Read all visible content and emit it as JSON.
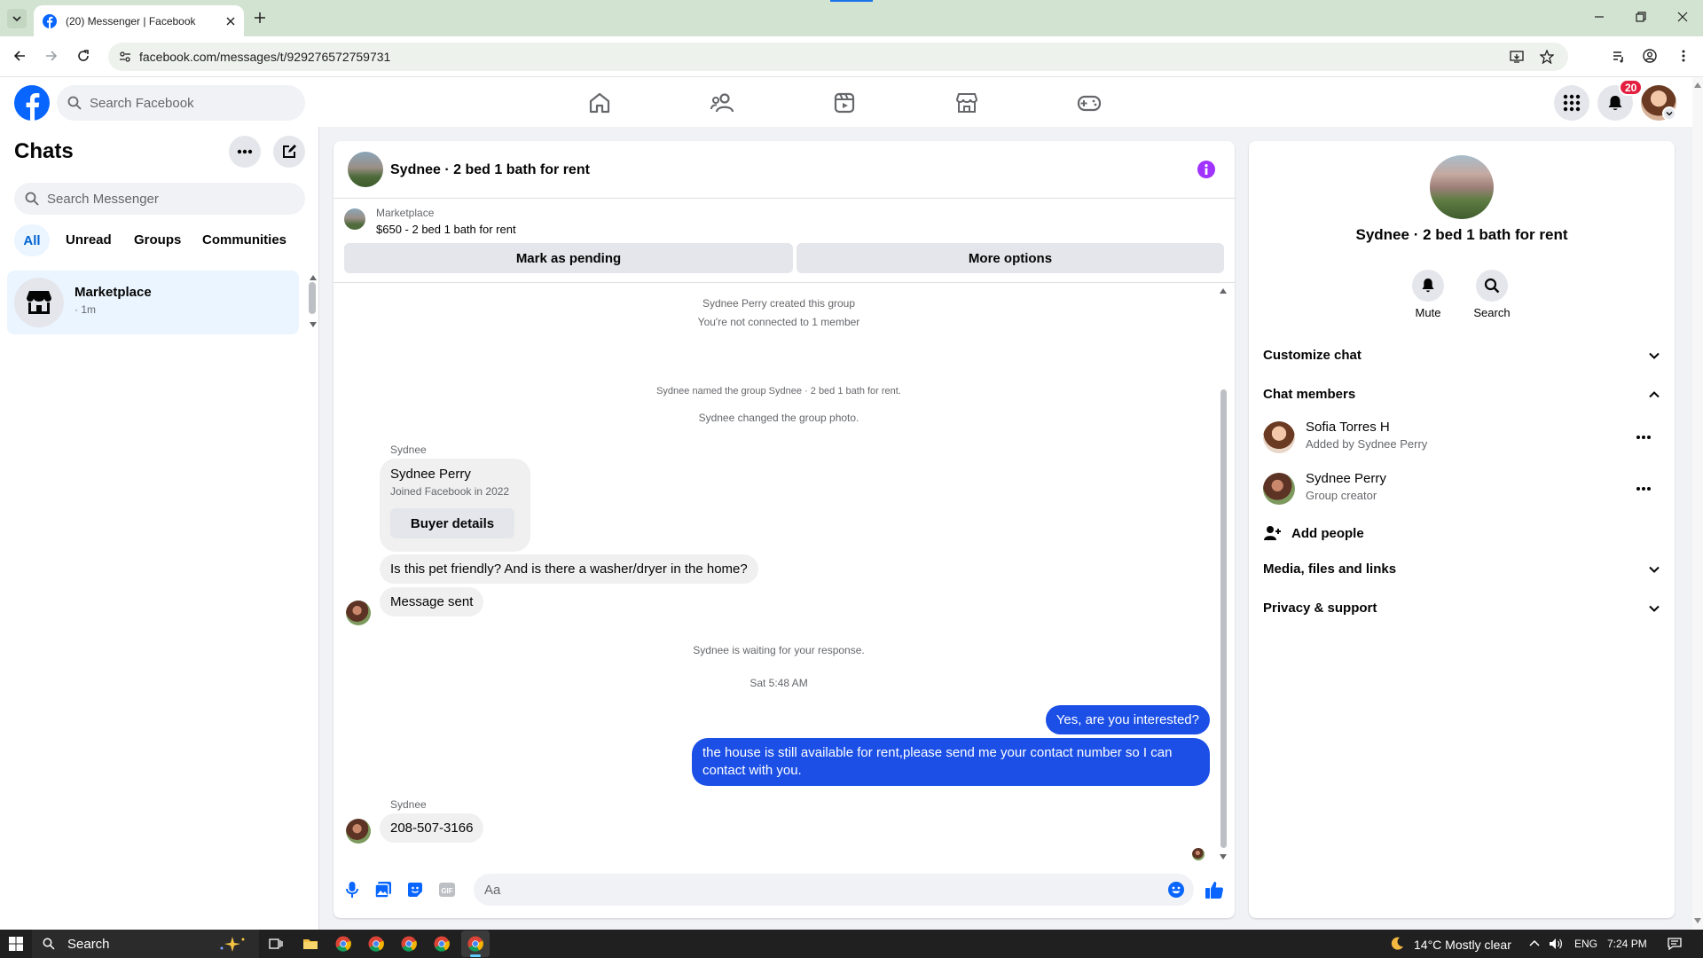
{
  "browser": {
    "tab_title": "(20) Messenger | Facebook",
    "url": "facebook.com/messages/t/929276572759731"
  },
  "fb_header": {
    "search_placeholder": "Search Facebook",
    "notification_count": "20"
  },
  "chats": {
    "title": "Chats",
    "search_placeholder": "Search Messenger",
    "filters": [
      "All",
      "Unread",
      "Groups",
      "Communities"
    ],
    "items": [
      {
        "name": "Marketplace",
        "meta": "· 1m"
      }
    ]
  },
  "conversation": {
    "title": "Sydnee · 2 bed 1 bath for rent",
    "marketplace_label": "Marketplace",
    "listing": "$650 - 2 bed 1 bath for rent",
    "mark_pending": "Mark as pending",
    "more_options": "More options",
    "sys1": "Sydnee Perry created this group",
    "sys2": "You're not connected to 1 member",
    "sys3": "Sydnee named the group Sydnee · 2 bed 1 bath for rent.",
    "sys4": "Sydnee changed the group photo.",
    "sender_name": "Sydnee",
    "card_name": "Sydnee Perry",
    "card_sub": "Joined Facebook in 2022",
    "card_button": "Buyer details",
    "msg1": "Is this pet friendly? And is there a washer/dryer in the home?",
    "msg2": "Message sent",
    "sys5": "Sydnee is waiting for your response.",
    "timestamp": "Sat 5:48 AM",
    "out1": "Yes, are you interested?",
    "out2": "the house is still available for rent,please send me your contact number so I can contact with you.",
    "sender_name2": "Sydnee",
    "msg3": "208-507-3166",
    "composer_placeholder": "Aa"
  },
  "info_panel": {
    "title": "Sydnee · 2 bed 1 bath for rent",
    "mute": "Mute",
    "search": "Search",
    "customize": "Customize chat",
    "members_header": "Chat members",
    "members": [
      {
        "name": "Sofia Torres H",
        "sub": "Added by Sydnee Perry"
      },
      {
        "name": "Sydnee Perry",
        "sub": "Group creator"
      }
    ],
    "add_people": "Add people",
    "media": "Media, files and links",
    "privacy": "Privacy & support"
  },
  "taskbar": {
    "search": "Search",
    "weather": "14°C  Mostly clear",
    "lang": "ENG",
    "time": "7:24 PM"
  },
  "colors": {
    "fb_blue": "#0866ff",
    "outgoing_bubble": "#1b4fe6",
    "info_purple": "#a033ff"
  }
}
